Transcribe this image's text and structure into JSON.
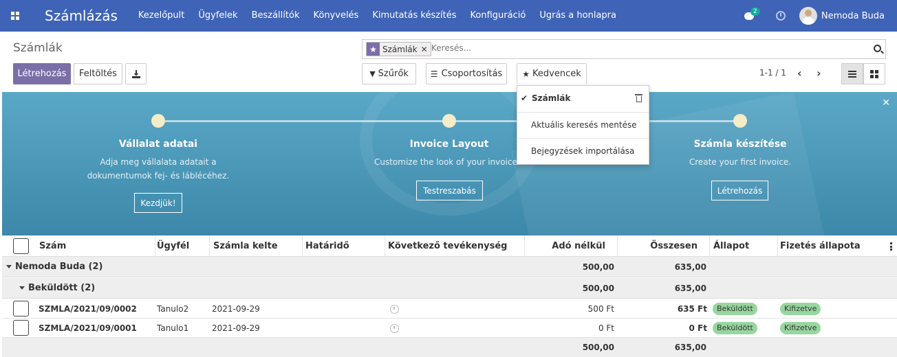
{
  "navbar": {
    "app_name": "Számlázás",
    "menu": [
      "Kezelőpult",
      "Ügyfelek",
      "Beszállítók",
      "Könyvelés",
      "Kimutatás készítés",
      "Konfiguráció",
      "Ugrás a honlapra"
    ],
    "chat_count": "2",
    "user_name": "Nemoda Buda"
  },
  "control": {
    "page_title": "Számlák",
    "create_label": "Létrehozás",
    "upload_label": "Feltöltés",
    "filters_label": "Szűrők",
    "group_by_label": "Csoportosítás",
    "favorites_label": "Kedvencek",
    "pager": "1-1 / 1"
  },
  "search": {
    "facet_label": "Számlák",
    "placeholder": "Keresés..."
  },
  "favorites_menu": {
    "items": [
      "Számlák",
      "Aktuális keresés mentése",
      "Bejegyzések importálása"
    ]
  },
  "banner": {
    "steps": [
      {
        "title": "Vállalat adatai",
        "desc_line1": "Adja meg vállalata adatait a",
        "desc_line2": "dokumentumok fej- és láblécéhez.",
        "button": "Kezdjük!"
      },
      {
        "title": "Invoice Layout",
        "desc_line1": "Customize the look of your invoices.",
        "desc_line2": "",
        "button": "Testreszabás"
      },
      {
        "title": "Számla készítése",
        "desc_line1": "Create your first invoice.",
        "desc_line2": "",
        "button": "Létrehozás"
      }
    ]
  },
  "table": {
    "columns": [
      "Szám",
      "Ügyfél",
      "Számla kelte",
      "Határidő",
      "Következő tevékenység",
      "Adó nélkül",
      "Összesen",
      "Állapot",
      "Fizetés állapota"
    ],
    "group1": {
      "label": "Nemoda Buda (2)",
      "untaxed": "500,00",
      "total": "635,00"
    },
    "group2": {
      "label": "Beküldött (2)",
      "untaxed": "500,00",
      "total": "635,00"
    },
    "rows": [
      {
        "number": "SZMLA/2021/09/0002",
        "partner": "Tanulo2",
        "date": "2021-09-29",
        "untaxed": "500 Ft",
        "total": "635 Ft",
        "state": "Beküldött",
        "payment": "Kifizetve"
      },
      {
        "number": "SZMLA/2021/09/0001",
        "partner": "Tanulo1",
        "date": "2021-09-29",
        "untaxed": "0 Ft",
        "total": "0 Ft",
        "state": "Beküldött",
        "payment": "Kifizetve"
      }
    ],
    "footer": {
      "untaxed": "500,00",
      "total": "635,00"
    }
  }
}
